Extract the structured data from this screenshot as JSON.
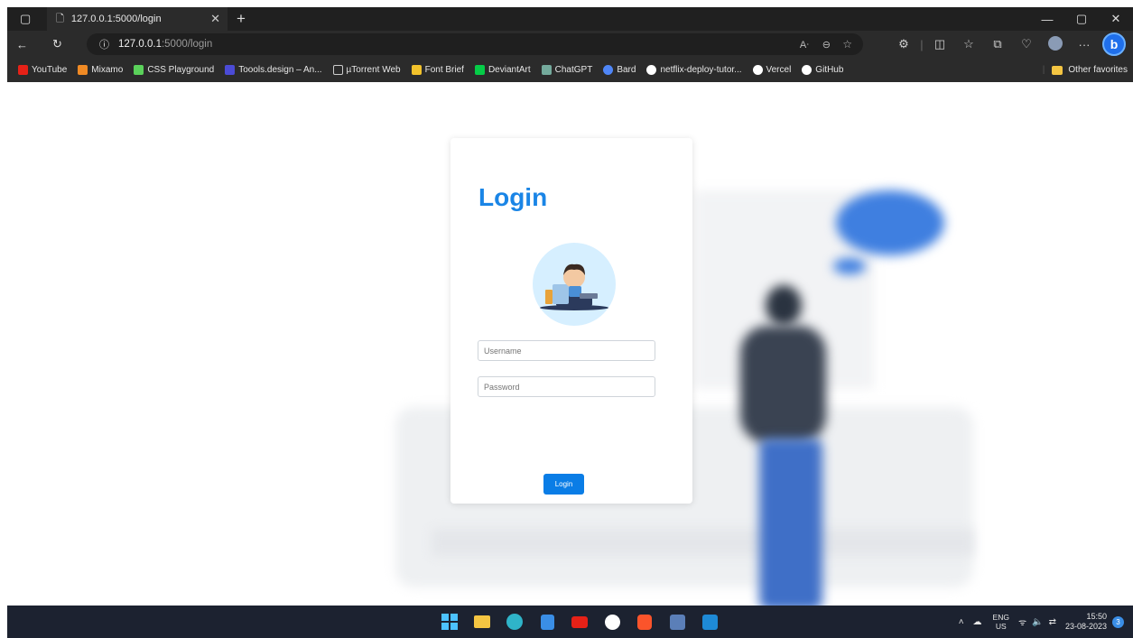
{
  "browser": {
    "tab_title": "127.0.0.1:5000/login",
    "address_host": "127.0.0.1",
    "address_path": ":5000/login",
    "bookmarks": [
      {
        "label": "YouTube",
        "color": "#e62117"
      },
      {
        "label": "Mixamo",
        "color": "#f08a24"
      },
      {
        "label": "CSS Playground",
        "color": "#5ad15a"
      },
      {
        "label": "Toools.design – An...",
        "color": "#4b4bd6"
      },
      {
        "label": "µTorrent Web",
        "color": "#cccccc"
      },
      {
        "label": "Font Brief",
        "color": "#f2c22b"
      },
      {
        "label": "DeviantArt",
        "color": "#05cc47"
      },
      {
        "label": "ChatGPT",
        "color": "#74aa9c"
      },
      {
        "label": "Bard",
        "color": "#4f86f7"
      },
      {
        "label": "netflix-deploy-tutor...",
        "color": "#ffffff"
      },
      {
        "label": "Vercel",
        "color": "#ffffff"
      },
      {
        "label": "GitHub",
        "color": "#ffffff"
      }
    ],
    "other_favorites": "Other favorites"
  },
  "login": {
    "title": "Login",
    "username_placeholder": "Username",
    "password_placeholder": "Password",
    "button_label": "Login",
    "accent": "#1a85e6"
  },
  "taskbar": {
    "lang_top": "ENG",
    "lang_bottom": "US",
    "time": "15:50",
    "date": "23-08-2023",
    "notification_count": "3"
  }
}
